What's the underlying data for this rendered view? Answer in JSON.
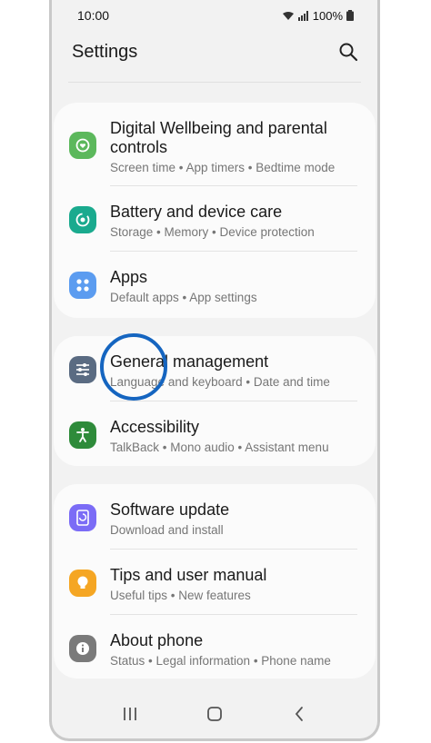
{
  "status": {
    "time": "10:00",
    "battery": "100%"
  },
  "header": {
    "title": "Settings"
  },
  "groups": [
    {
      "items": [
        {
          "title": "Digital Wellbeing and parental controls",
          "subtitle": "Screen time  •  App timers  •  Bedtime mode",
          "icon": "wellbeing-icon",
          "color": "#5cb85c"
        },
        {
          "title": "Battery and device care",
          "subtitle": "Storage  •  Memory  •  Device protection",
          "icon": "device-care-icon",
          "color": "#1aaa8e"
        },
        {
          "title": "Apps",
          "subtitle": "Default apps  •  App settings",
          "icon": "apps-icon",
          "color": "#5b9cf0"
        }
      ]
    },
    {
      "items": [
        {
          "title": "General management",
          "subtitle": "Language and keyboard  •  Date and time",
          "icon": "sliders-icon",
          "color": "#5a6b82"
        },
        {
          "title": "Accessibility",
          "subtitle": "TalkBack  •  Mono audio  •  Assistant menu",
          "icon": "accessibility-icon",
          "color": "#2e8b3a"
        }
      ]
    },
    {
      "items": [
        {
          "title": "Software update",
          "subtitle": "Download and install",
          "icon": "software-update-icon",
          "color": "#7b6cf6"
        },
        {
          "title": "Tips and user manual",
          "subtitle": "Useful tips  •  New features",
          "icon": "lightbulb-icon",
          "color": "#f5a623"
        },
        {
          "title": "About phone",
          "subtitle": "Status  •  Legal information  •  Phone name",
          "icon": "info-icon",
          "color": "#7a7a7a"
        }
      ]
    }
  ],
  "accent": "#1565c0"
}
